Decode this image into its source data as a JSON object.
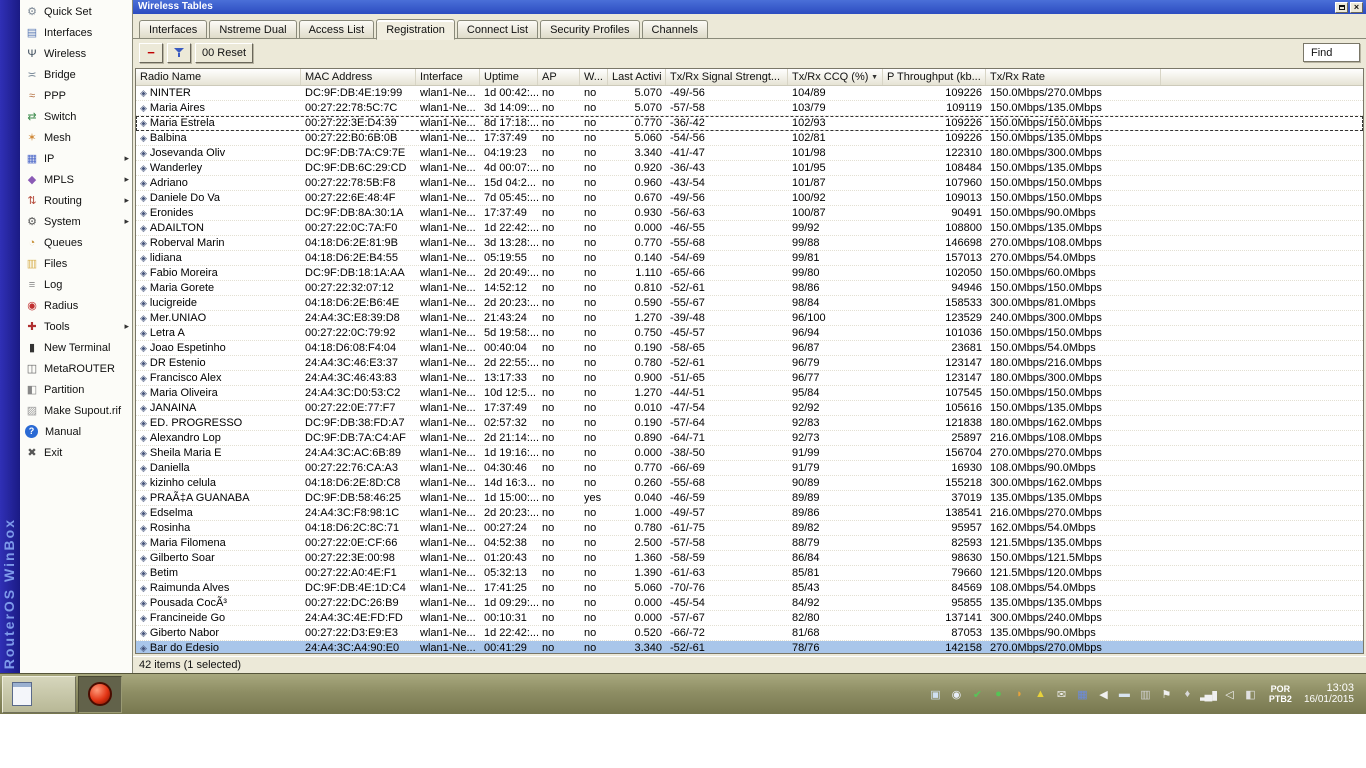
{
  "brand": "RouterOS WinBox",
  "colors": {
    "titlebar": "#2c4cc0",
    "selection": "#a9c6ea",
    "brand_strip": "#2525a0",
    "taskbar": "#8e8e64",
    "remove_accent": "#c00000"
  },
  "icons": {
    "submenu_arrow": "▸",
    "sort_desc": "▼",
    "remove": "−",
    "close": "×",
    "row_marker": "◈"
  },
  "window": {
    "title": "Wireless Tables",
    "status": "42 items (1 selected)"
  },
  "sidebar": [
    {
      "label": "Quick Set",
      "icon": "quick-set-icon",
      "glyph": "⚙",
      "color": "#7a8694",
      "sub": false
    },
    {
      "label": "Interfaces",
      "icon": "interfaces-icon",
      "glyph": "▤",
      "color": "#5a7ab5",
      "sub": false
    },
    {
      "label": "Wireless",
      "icon": "wireless-icon",
      "glyph": "Ψ",
      "color": "#3a4a5a",
      "sub": false
    },
    {
      "label": "Bridge",
      "icon": "bridge-icon",
      "glyph": "≍",
      "color": "#7a8a9a",
      "sub": false
    },
    {
      "label": "PPP",
      "icon": "ppp-icon",
      "glyph": "≈",
      "color": "#b06a3a",
      "sub": false
    },
    {
      "label": "Switch",
      "icon": "switch-icon",
      "glyph": "⇄",
      "color": "#3a8a4a",
      "sub": false
    },
    {
      "label": "Mesh",
      "icon": "mesh-icon",
      "glyph": "✶",
      "color": "#d08a3a",
      "sub": false
    },
    {
      "label": "IP",
      "icon": "ip-icon",
      "glyph": "▦",
      "color": "#4a66c8",
      "sub": true
    },
    {
      "label": "MPLS",
      "icon": "mpls-icon",
      "glyph": "◆",
      "color": "#8a5ab5",
      "sub": true
    },
    {
      "label": "Routing",
      "icon": "routing-icon",
      "glyph": "⇅",
      "color": "#b54a3a",
      "sub": true
    },
    {
      "label": "System",
      "icon": "system-icon",
      "glyph": "⚙",
      "color": "#555555",
      "sub": true
    },
    {
      "label": "Queues",
      "icon": "queues-icon",
      "glyph": "◔",
      "color": "#c8923a",
      "sub": false
    },
    {
      "label": "Files",
      "icon": "files-icon",
      "glyph": "▥",
      "color": "#d8b050",
      "sub": false
    },
    {
      "label": "Log",
      "icon": "log-icon",
      "glyph": "≡",
      "color": "#8a8a8a",
      "sub": false
    },
    {
      "label": "Radius",
      "icon": "radius-icon",
      "glyph": "◉",
      "color": "#c03030",
      "sub": false
    },
    {
      "label": "Tools",
      "icon": "tools-icon",
      "glyph": "✚",
      "color": "#b03030",
      "sub": true
    },
    {
      "label": "New Terminal",
      "icon": "new-terminal-icon",
      "glyph": "▮",
      "color": "#333333",
      "sub": false
    },
    {
      "label": "MetaROUTER",
      "icon": "metarouter-icon",
      "glyph": "◫",
      "color": "#666666",
      "sub": false
    },
    {
      "label": "Partition",
      "icon": "partition-icon",
      "glyph": "◧",
      "color": "#888888",
      "sub": false
    },
    {
      "label": "Make Supout.rif",
      "icon": "make-supout-icon",
      "glyph": "▨",
      "color": "#999999",
      "sub": false
    },
    {
      "label": "Manual",
      "icon": "manual-icon",
      "glyph": "?",
      "color": "#ffffff",
      "sub": false
    },
    {
      "label": "Exit",
      "icon": "exit-icon",
      "glyph": "✖",
      "color": "#555555",
      "sub": false
    }
  ],
  "tabs": [
    {
      "label": "Interfaces",
      "active": false
    },
    {
      "label": "Nstreme Dual",
      "active": false
    },
    {
      "label": "Access List",
      "active": false
    },
    {
      "label": "Registration",
      "active": true
    },
    {
      "label": "Connect List",
      "active": false
    },
    {
      "label": "Security Profiles",
      "active": false
    },
    {
      "label": "Channels",
      "active": false
    }
  ],
  "toolbar": {
    "reset_label": "00 Reset",
    "find_label": "Find"
  },
  "table": {
    "columns": [
      {
        "label": "Radio Name"
      },
      {
        "label": "MAC Address"
      },
      {
        "label": "Interface"
      },
      {
        "label": "Uptime"
      },
      {
        "label": "AP"
      },
      {
        "label": "W..."
      },
      {
        "label": "Last Activit..."
      },
      {
        "label": "Tx/Rx Signal Strengt..."
      },
      {
        "label": "Tx/Rx CCQ (%)",
        "sort": "desc"
      },
      {
        "label": "P Throughput (kb..."
      },
      {
        "label": "Tx/Rx Rate"
      }
    ],
    "focused_row": 2,
    "selected_row": 37,
    "rows": [
      [
        "NINTER",
        "DC:9F:DB:4E:19:99",
        "wlan1-Ne...",
        "1d 00:42:...",
        "no",
        "no",
        "5.070",
        "-49/-56",
        "104/89",
        "109226",
        "150.0Mbps/270.0Mbps"
      ],
      [
        "Maria Aires",
        "00:27:22:78:5C:7C",
        "wlan1-Ne...",
        "3d 14:09:...",
        "no",
        "no",
        "5.070",
        "-57/-58",
        "103/79",
        "109119",
        "150.0Mbps/135.0Mbps"
      ],
      [
        "Maria Estrela",
        "00:27:22:3E:D4:39",
        "wlan1-Ne...",
        "8d 17:18:...",
        "no",
        "no",
        "0.770",
        "-36/-42",
        "102/93",
        "109226",
        "150.0Mbps/150.0Mbps"
      ],
      [
        "Balbina",
        "00:27:22:B0:6B:0B",
        "wlan1-Ne...",
        "17:37:49",
        "no",
        "no",
        "5.060",
        "-54/-56",
        "102/81",
        "109226",
        "150.0Mbps/135.0Mbps"
      ],
      [
        "Josevanda Oliv",
        "DC:9F:DB:7A:C9:7E",
        "wlan1-Ne...",
        "04:19:23",
        "no",
        "no",
        "3.340",
        "-41/-47",
        "101/98",
        "122310",
        "180.0Mbps/300.0Mbps"
      ],
      [
        "Wanderley",
        "DC:9F:DB:6C:29:CD",
        "wlan1-Ne...",
        "4d 00:07:...",
        "no",
        "no",
        "0.920",
        "-36/-43",
        "101/95",
        "108484",
        "150.0Mbps/135.0Mbps"
      ],
      [
        "Adriano",
        "00:27:22:78:5B:F8",
        "wlan1-Ne...",
        "15d 04:2...",
        "no",
        "no",
        "0.960",
        "-43/-54",
        "101/87",
        "107960",
        "150.0Mbps/150.0Mbps"
      ],
      [
        "Daniele Do Va",
        "00:27:22:6E:48:4F",
        "wlan1-Ne...",
        "7d 05:45:...",
        "no",
        "no",
        "0.670",
        "-49/-56",
        "100/92",
        "109013",
        "150.0Mbps/150.0Mbps"
      ],
      [
        "Eronides",
        "DC:9F:DB:8A:30:1A",
        "wlan1-Ne...",
        "17:37:49",
        "no",
        "no",
        "0.930",
        "-56/-63",
        "100/87",
        "90491",
        "150.0Mbps/90.0Mbps"
      ],
      [
        "ADAILTON",
        "00:27:22:0C:7A:F0",
        "wlan1-Ne...",
        "1d 22:42:...",
        "no",
        "no",
        "0.000",
        "-46/-55",
        "99/92",
        "108800",
        "150.0Mbps/135.0Mbps"
      ],
      [
        "Roberval Marin",
        "04:18:D6:2E:81:9B",
        "wlan1-Ne...",
        "3d 13:28:...",
        "no",
        "no",
        "0.770",
        "-55/-68",
        "99/88",
        "146698",
        "270.0Mbps/108.0Mbps"
      ],
      [
        "lidiana",
        "04:18:D6:2E:B4:55",
        "wlan1-Ne...",
        "05:19:55",
        "no",
        "no",
        "0.140",
        "-54/-69",
        "99/81",
        "157013",
        "270.0Mbps/54.0Mbps"
      ],
      [
        "Fabio Moreira",
        "DC:9F:DB:18:1A:AA",
        "wlan1-Ne...",
        "2d 20:49:...",
        "no",
        "no",
        "1.110",
        "-65/-66",
        "99/80",
        "102050",
        "150.0Mbps/60.0Mbps"
      ],
      [
        "Maria Gorete",
        "00:27:22:32:07:12",
        "wlan1-Ne...",
        "14:52:12",
        "no",
        "no",
        "0.810",
        "-52/-61",
        "98/86",
        "94946",
        "150.0Mbps/150.0Mbps"
      ],
      [
        "lucigreide",
        "04:18:D6:2E:B6:4E",
        "wlan1-Ne...",
        "2d 20:23:...",
        "no",
        "no",
        "0.590",
        "-55/-67",
        "98/84",
        "158533",
        "300.0Mbps/81.0Mbps"
      ],
      [
        "Mer.UNIAO",
        "24:A4:3C:E8:39:D8",
        "wlan1-Ne...",
        "21:43:24",
        "no",
        "no",
        "1.270",
        "-39/-48",
        "96/100",
        "123529",
        "240.0Mbps/300.0Mbps"
      ],
      [
        "Letra A",
        "00:27:22:0C:79:92",
        "wlan1-Ne...",
        "5d 19:58:...",
        "no",
        "no",
        "0.750",
        "-45/-57",
        "96/94",
        "101036",
        "150.0Mbps/150.0Mbps"
      ],
      [
        "Joao Espetinho",
        "04:18:D6:08:F4:04",
        "wlan1-Ne...",
        "00:40:04",
        "no",
        "no",
        "0.190",
        "-58/-65",
        "96/87",
        "23681",
        "150.0Mbps/54.0Mbps"
      ],
      [
        "DR Estenio",
        "24:A4:3C:46:E3:37",
        "wlan1-Ne...",
        "2d 22:55:...",
        "no",
        "no",
        "0.780",
        "-52/-61",
        "96/79",
        "123147",
        "180.0Mbps/216.0Mbps"
      ],
      [
        "Francisco Alex",
        "24:A4:3C:46:43:83",
        "wlan1-Ne...",
        "13:17:33",
        "no",
        "no",
        "0.900",
        "-51/-65",
        "96/77",
        "123147",
        "180.0Mbps/300.0Mbps"
      ],
      [
        "Maria Oliveira",
        "24:A4:3C:D0:53:C2",
        "wlan1-Ne...",
        "10d 12:5...",
        "no",
        "no",
        "1.270",
        "-44/-51",
        "95/84",
        "107545",
        "150.0Mbps/150.0Mbps"
      ],
      [
        "JANAINA",
        "00:27:22:0E:77:F7",
        "wlan1-Ne...",
        "17:37:49",
        "no",
        "no",
        "0.010",
        "-47/-54",
        "92/92",
        "105616",
        "150.0Mbps/135.0Mbps"
      ],
      [
        "ED. PROGRESSO",
        "DC:9F:DB:38:FD:A7",
        "wlan1-Ne...",
        "02:57:32",
        "no",
        "no",
        "0.190",
        "-57/-64",
        "92/83",
        "121838",
        "180.0Mbps/162.0Mbps"
      ],
      [
        "Alexandro Lop",
        "DC:9F:DB:7A:C4:AF",
        "wlan1-Ne...",
        "2d 21:14:...",
        "no",
        "no",
        "0.890",
        "-64/-71",
        "92/73",
        "25897",
        "216.0Mbps/108.0Mbps"
      ],
      [
        "Sheila Maria E",
        "24:A4:3C:AC:6B:89",
        "wlan1-Ne...",
        "1d 19:16:...",
        "no",
        "no",
        "0.000",
        "-38/-50",
        "91/99",
        "156704",
        "270.0Mbps/270.0Mbps"
      ],
      [
        "Daniella",
        "00:27:22:76:CA:A3",
        "wlan1-Ne...",
        "04:30:46",
        "no",
        "no",
        "0.770",
        "-66/-69",
        "91/79",
        "16930",
        "108.0Mbps/90.0Mbps"
      ],
      [
        "kizinho celula",
        "04:18:D6:2E:8D:C8",
        "wlan1-Ne...",
        "14d 16:3...",
        "no",
        "no",
        "0.260",
        "-55/-68",
        "90/89",
        "155218",
        "300.0Mbps/162.0Mbps"
      ],
      [
        "PRAÃ‡A GUANABA",
        "DC:9F:DB:58:46:25",
        "wlan1-Ne...",
        "1d 15:00:...",
        "no",
        "yes",
        "0.040",
        "-46/-59",
        "89/89",
        "37019",
        "135.0Mbps/135.0Mbps"
      ],
      [
        "Edselma",
        "24:A4:3C:F8:98:1C",
        "wlan1-Ne...",
        "2d 20:23:...",
        "no",
        "no",
        "1.000",
        "-49/-57",
        "89/86",
        "138541",
        "216.0Mbps/270.0Mbps"
      ],
      [
        "Rosinha",
        "04:18:D6:2C:8C:71",
        "wlan1-Ne...",
        "00:27:24",
        "no",
        "no",
        "0.780",
        "-61/-75",
        "89/82",
        "95957",
        "162.0Mbps/54.0Mbps"
      ],
      [
        "Maria Filomena",
        "00:27:22:0E:CF:66",
        "wlan1-Ne...",
        "04:52:38",
        "no",
        "no",
        "2.500",
        "-57/-58",
        "88/79",
        "82593",
        "121.5Mbps/135.0Mbps"
      ],
      [
        "Gilberto Soar",
        "00:27:22:3E:00:98",
        "wlan1-Ne...",
        "01:20:43",
        "no",
        "no",
        "1.360",
        "-58/-59",
        "86/84",
        "98630",
        "150.0Mbps/121.5Mbps"
      ],
      [
        "Betim",
        "00:27:22:A0:4E:F1",
        "wlan1-Ne...",
        "05:32:13",
        "no",
        "no",
        "1.390",
        "-61/-63",
        "85/81",
        "79660",
        "121.5Mbps/120.0Mbps"
      ],
      [
        "Raimunda Alves",
        "DC:9F:DB:4E:1D:C4",
        "wlan1-Ne...",
        "17:41:25",
        "no",
        "no",
        "5.060",
        "-70/-76",
        "85/43",
        "84569",
        "108.0Mbps/54.0Mbps"
      ],
      [
        "Pousada CocÃ³",
        "00:27:22:DC:26:B9",
        "wlan1-Ne...",
        "1d 09:29:...",
        "no",
        "no",
        "0.000",
        "-45/-54",
        "84/92",
        "95855",
        "135.0Mbps/135.0Mbps"
      ],
      [
        "Francineide Go",
        "24:A4:3C:4E:FD:FD",
        "wlan1-Ne...",
        "00:10:31",
        "no",
        "no",
        "0.000",
        "-57/-67",
        "82/80",
        "137141",
        "300.0Mbps/240.0Mbps"
      ],
      [
        "Giberto Nabor",
        "00:27:22:D3:E9:E3",
        "wlan1-Ne...",
        "1d 22:42:...",
        "no",
        "no",
        "0.520",
        "-66/-72",
        "81/68",
        "87053",
        "135.0Mbps/90.0Mbps"
      ],
      [
        "Bar do Edesio",
        "24:A4:3C:A4:90:E0",
        "wlan1-Ne...",
        "00:41:29",
        "no",
        "no",
        "3.340",
        "-52/-61",
        "78/76",
        "142158",
        "270.0Mbps/270.0Mbps"
      ]
    ]
  },
  "taskbar": {
    "language": "POR",
    "layout": "PTB2",
    "time": "13:03",
    "date": "16/01/2015",
    "tray": [
      {
        "name": "tray-display-icon",
        "glyph": "▣",
        "color": "#cfe0f2"
      },
      {
        "name": "tray-camera-icon",
        "glyph": "◉",
        "color": "#e8eef8"
      },
      {
        "name": "tray-antivirus-icon",
        "glyph": "✔",
        "color": "#58c458"
      },
      {
        "name": "tray-update-icon",
        "glyph": "●",
        "color": "#55c455"
      },
      {
        "name": "tray-java-icon",
        "glyph": "◗",
        "color": "#e8a23a"
      },
      {
        "name": "tray-warning-icon",
        "glyph": "▲",
        "color": "#e8d23a"
      },
      {
        "name": "tray-mail-icon",
        "glyph": "✉",
        "color": "#f0f0f0"
      },
      {
        "name": "tray-network-icon",
        "glyph": "▦",
        "color": "#6a8ae0"
      },
      {
        "name": "tray-volume-icon",
        "glyph": "◀",
        "color": "#f0f0f0"
      },
      {
        "name": "tray-monitor-icon",
        "glyph": "▬",
        "color": "#d8e4f0"
      },
      {
        "name": "tray-messenger-icon",
        "glyph": "▥",
        "color": "#d0d0d0"
      },
      {
        "name": "tray-flag-icon",
        "glyph": "⚑",
        "color": "#f0f0f0"
      },
      {
        "name": "tray-usb-icon",
        "glyph": "♦",
        "color": "#d8d8d8"
      },
      {
        "name": "tray-signal-icon",
        "glyph": "▂▄▆",
        "color": "#f0f0f0"
      },
      {
        "name": "tray-sound-icon",
        "glyph": "◁",
        "color": "#f0f0f0"
      },
      {
        "name": "tray-tasks-icon",
        "glyph": "◧",
        "color": "#e0e0e0"
      }
    ]
  }
}
